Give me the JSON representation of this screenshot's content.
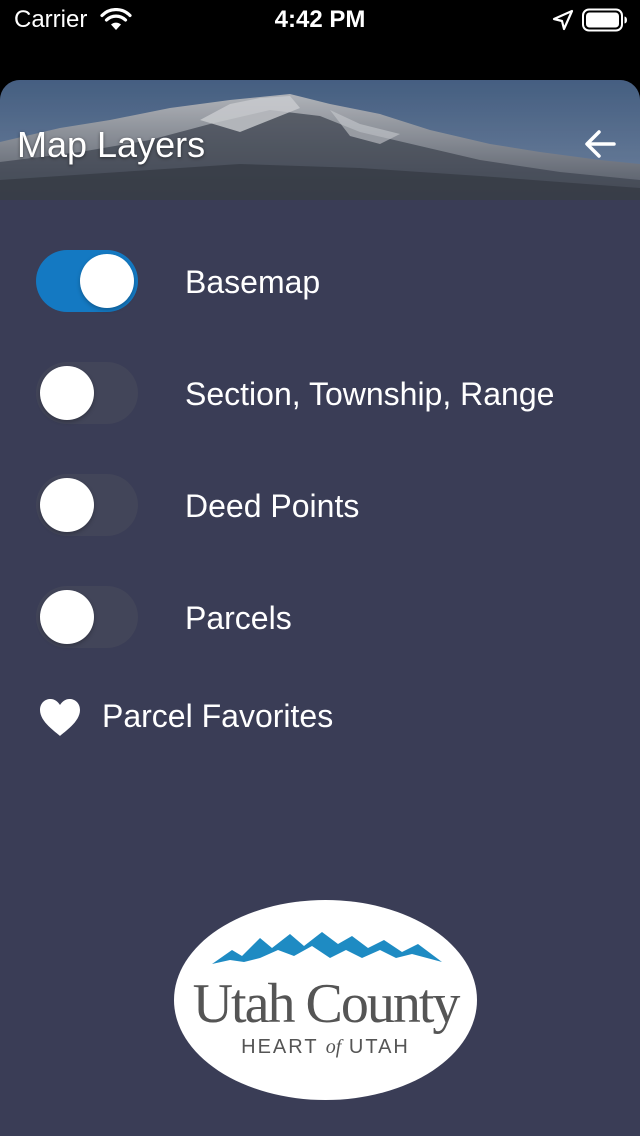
{
  "status_bar": {
    "carrier": "Carrier",
    "time": "4:42 PM",
    "icons": [
      "wifi-icon",
      "location-arrow-icon",
      "battery-icon"
    ]
  },
  "header": {
    "title": "Map Layers",
    "back_icon": "arrow-left-icon"
  },
  "layers": [
    {
      "label": "Basemap",
      "enabled": true
    },
    {
      "label": "Section, Township, Range",
      "enabled": false
    },
    {
      "label": "Deed Points",
      "enabled": false
    },
    {
      "label": "Parcels",
      "enabled": false
    }
  ],
  "favorites": {
    "label": "Parcel Favorites",
    "icon": "heart-icon"
  },
  "logo": {
    "name": "Utah County",
    "tagline_before": "HEART",
    "tagline_of": "of",
    "tagline_after": "UTAH"
  },
  "colors": {
    "panel_background": "#3a3d56",
    "toggle_on": "#1479c2",
    "toggle_off": "#424559",
    "logo_mountains": "#1e8bc3"
  }
}
